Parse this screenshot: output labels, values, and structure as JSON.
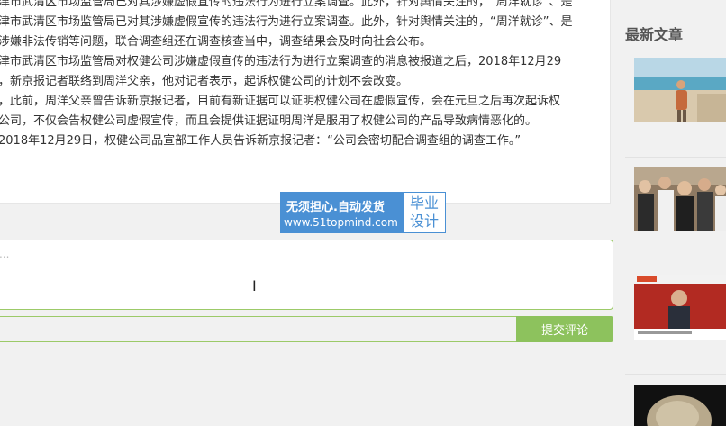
{
  "article": {
    "lines": [
      "津市武清区市场监管局已对其涉嫌虚假宣传的违法行为进行立案调查。此外，针对舆情关注的，“周洋就诊”、是",
      "涉嫌非法传销等问题，联合调查组还在调查核查当中，调查结果会及时向社会公布。",
      "津市武清区市场监管局对权健公司涉嫌虚假宣传的违法行为进行立案调查的消息被报道之后，2018年12月29",
      "，新京报记者联络到周洋父亲，他对记者表示，起诉权健公司的计划不会改变。",
      "，此前，周洋父亲曾告诉新京报记者，目前有新证据可以证明权健公司在虚假宣传，会在元旦之后再次起诉权",
      "公司，不仅会告权健公司虚假宣传，而且会提供证据证明周洋是服用了权健公司的产品导致病情恶化的。",
      "2018年12月29日，权健公司品宣部工作人员告诉新京报记者：“公司会密切配合调查组的调查工作。”"
    ]
  },
  "banner": {
    "slogan": "无须担心.自动发货",
    "url": "www.51topmind.com",
    "tag_line1": "毕业",
    "tag_line2": "设计"
  },
  "comment": {
    "placeholder": "...",
    "submit_label": "提交评论"
  },
  "sidebar": {
    "title": "最新文章"
  },
  "colors": {
    "accent_green": "#8dc25d",
    "banner_blue": "#4a90d4"
  }
}
